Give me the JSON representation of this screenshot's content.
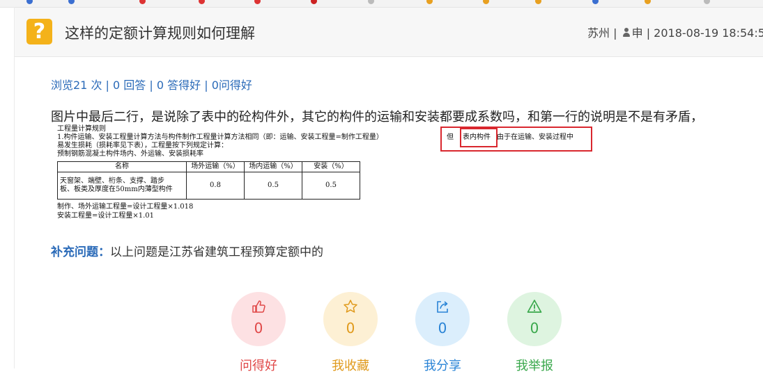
{
  "page": {
    "title": "这样的定额计算规则如何理解",
    "meta": {
      "location": "苏州 |",
      "author": "申",
      "sep": "|",
      "datetime": "2018-08-19 18:54:5"
    },
    "stats": {
      "views": "浏览21 次",
      "answers": "0 回答",
      "good_answers": "0 答得好",
      "good_questions": "0问得好",
      "sep": "|"
    },
    "question_text": "图片中最后二行，是说除了表中的砼构件外，其它的构件的运输和安装都要成系数吗，和第一行的说明是不是有矛盾，",
    "document": {
      "line1": "工程量计算规则",
      "line2": "1.构件运输、安装工程量计算方法与构件制作工程量计算方法相同（即：运输、安装工程量=制作工程量）",
      "highlight_pre": "但",
      "highlight_mid": "表内构件",
      "highlight_post": "由于在运输、安装过程中",
      "line3": "易发生损耗（损耗率见下表），工程量按下列规定计算：",
      "line4": "预制钢筋混凝土构件场内、外运输、安装损耗率",
      "table": {
        "headers": [
          "名称",
          "场外运输（%）",
          "场内运输（%）",
          "安装（%）"
        ],
        "row_name_1": "天窗架、端壁、桁条、支撑、踏步",
        "row_name_2": "板、板类及厚度在50mm内薄型构件",
        "row_values": [
          "0.8",
          "0.5",
          "0.5"
        ]
      },
      "formula1": "制作、场外运输工程量=设计工程量×1.018",
      "formula2": "安装工程量=设计工程量×1.01"
    },
    "supplement": {
      "label": "补充问题：",
      "text": "以上问题是江苏省建筑工程预算定额中的"
    },
    "actions": [
      {
        "label": "问得好",
        "count": "0",
        "color": "#e04848",
        "bg": "#fde1e3",
        "icon": "thumbs-up-icon"
      },
      {
        "label": "我收藏",
        "count": "0",
        "color": "#e09a1c",
        "bg": "#fdf0d4",
        "icon": "star-icon"
      },
      {
        "label": "我分享",
        "count": "0",
        "color": "#2a84d6",
        "bg": "#dbeefc",
        "icon": "share-icon"
      },
      {
        "label": "我举报",
        "count": "0",
        "color": "#3aa84c",
        "bg": "#def4e0",
        "icon": "warning-icon"
      }
    ]
  }
}
